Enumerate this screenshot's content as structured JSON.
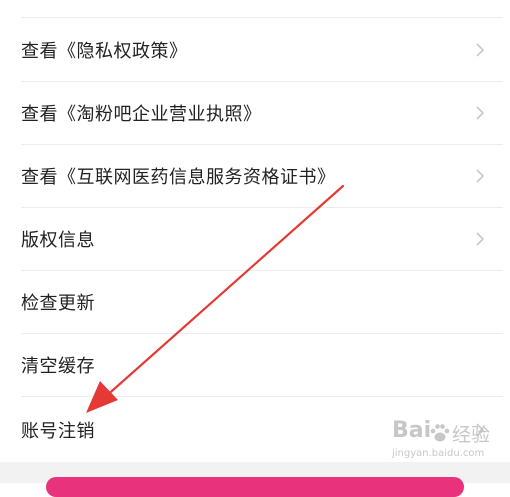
{
  "menu": {
    "items": [
      {
        "label": "查看《隐私权政策》",
        "chevron": true
      },
      {
        "label": "查看《淘粉吧企业营业执照》",
        "chevron": true
      },
      {
        "label": "查看《互联网医药信息服务资格证书》",
        "chevron": true
      },
      {
        "label": "版权信息",
        "chevron": true
      },
      {
        "label": "检查更新",
        "chevron": false
      },
      {
        "label": "清空缓存",
        "chevron": false
      },
      {
        "label": "账号注销",
        "chevron": true
      }
    ]
  },
  "watermark": {
    "text": "Bai",
    "text2": "经验",
    "url": "jingyan.baidu.com"
  },
  "colors": {
    "accent": "#e8327c",
    "annotation_arrow": "#e53935",
    "divider": "#ececec"
  },
  "icons": {
    "row_chevron": "chevron-right-icon",
    "watermark_logo": "paw-icon"
  }
}
